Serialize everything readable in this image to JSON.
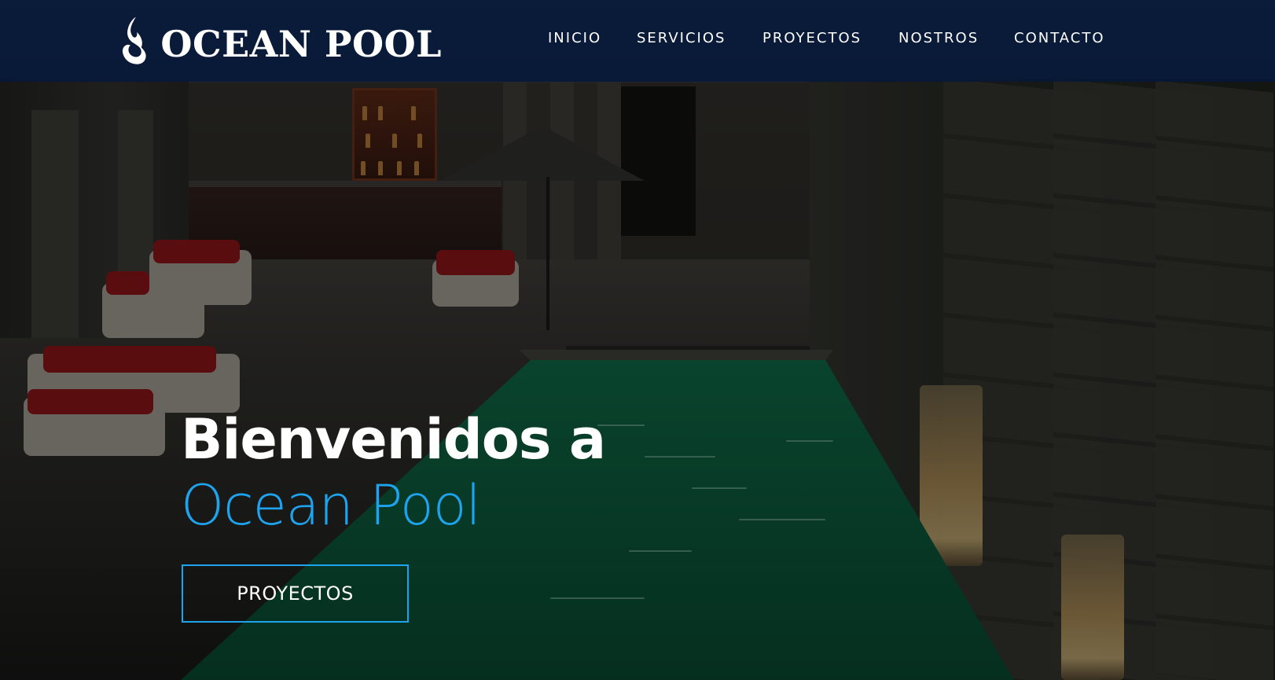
{
  "header": {
    "logo_text": "OCEAN POOL",
    "logo_icon": "flame-swirl-icon"
  },
  "nav": {
    "items": [
      {
        "label": "INICIO"
      },
      {
        "label": "SERVICIOS"
      },
      {
        "label": "PROYECTOS"
      },
      {
        "label": "NOSTROS"
      },
      {
        "label": "CONTACTO"
      }
    ]
  },
  "hero": {
    "title_line1": "Bienvenidos a",
    "title_line2": "Ocean Pool",
    "cta_label": "PROYECTOS"
  },
  "colors": {
    "header_bg": "#06183a",
    "accent": "#1ea4ef",
    "text": "#ffffff"
  }
}
